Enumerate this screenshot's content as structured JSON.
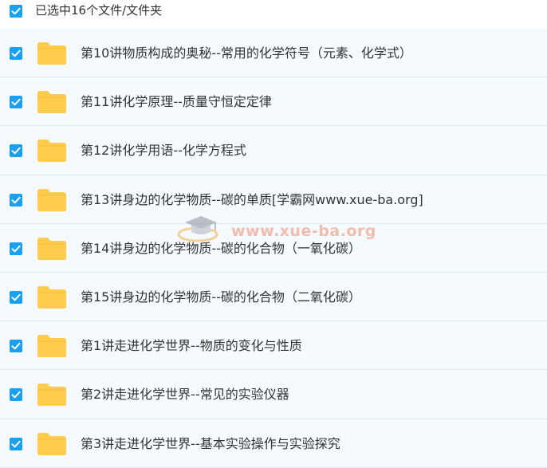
{
  "header": {
    "select_all_label": "已选中16个文件/文件夹",
    "select_all_checked": true
  },
  "items": [
    {
      "name": "第10讲物质构成的奥秘--常用的化学符号（元素、化学式）",
      "type": "folder",
      "checked": true
    },
    {
      "name": "第11讲化学原理--质量守恒定定律",
      "type": "folder",
      "checked": true
    },
    {
      "name": "第12讲化学用语--化学方程式",
      "type": "folder",
      "checked": true
    },
    {
      "name": "第13讲身边的化学物质--碳的单质[学霸网www.xue-ba.org]",
      "type": "folder",
      "checked": true
    },
    {
      "name": "第14讲身边的化学物质--碳的化合物（一氧化碳）",
      "type": "folder",
      "checked": true
    },
    {
      "name": "第15讲身边的化学物质--碳的化合物（二氧化碳）",
      "type": "folder",
      "checked": true
    },
    {
      "name": "第1讲走进化学世界--物质的变化与性质",
      "type": "folder",
      "checked": true
    },
    {
      "name": "第2讲走进化学世界--常见的实验仪器",
      "type": "folder",
      "checked": true
    },
    {
      "name": "第3讲走进化学世界--基本实验操作与实验探究",
      "type": "folder",
      "checked": true
    }
  ],
  "watermark": {
    "text": "www.xue-ba.org",
    "icon": "graduation-cap-icon"
  },
  "colors": {
    "checkbox": "#1aa0f0",
    "folder": "#ffcc4d",
    "row_bg": "#f5fafe",
    "row_border": "#dcebf6",
    "text": "#333333"
  }
}
